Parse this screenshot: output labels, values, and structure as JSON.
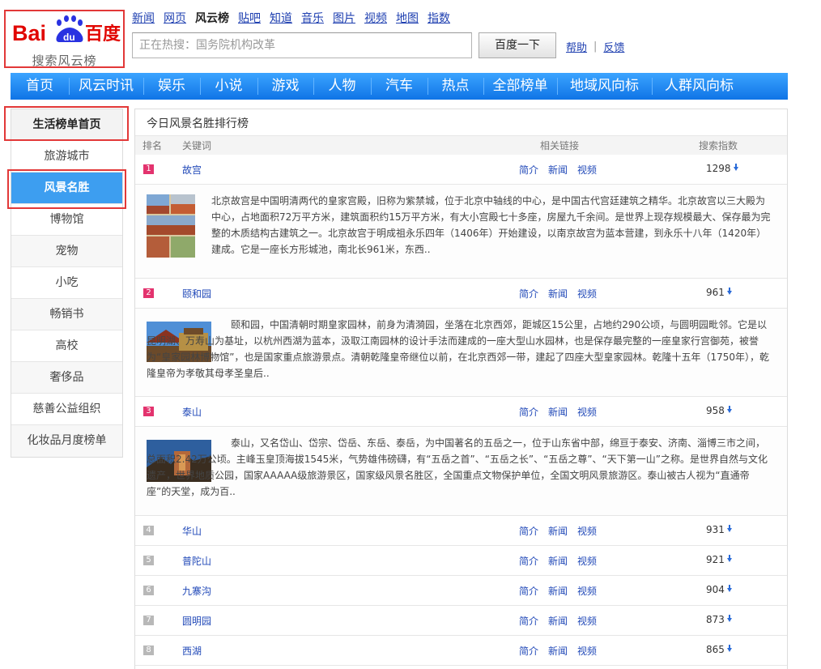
{
  "logo": {
    "text": "Bai百度",
    "du": "du",
    "sub": "搜索风云榜"
  },
  "topnav": [
    "新闻",
    "网页",
    "风云榜",
    "贴吧",
    "知道",
    "音乐",
    "图片",
    "视频",
    "地图",
    "指数"
  ],
  "search": {
    "placeholder": "正在热搜：国务院机构改革",
    "button": "百度一下",
    "help": "帮助",
    "sep": "|",
    "feedback": "反馈"
  },
  "mainnav": [
    "首页",
    "风云时讯",
    "娱乐",
    "小说",
    "游戏",
    "人物",
    "汽车",
    "热点",
    "全部榜单",
    "地域风向标",
    "人群风向标"
  ],
  "sidebar": [
    "生活榜单首页",
    "旅游城市",
    "风景名胜",
    "博物馆",
    "宠物",
    "小吃",
    "畅销书",
    "高校",
    "奢侈品",
    "慈善公益组织",
    "化妆品月度榜单"
  ],
  "panel": {
    "title": "今日风景名胜排行榜",
    "cols": {
      "rank": "排名",
      "keyword": "关键词",
      "links": "相关链接",
      "index": "搜索指数"
    },
    "link_labels": [
      "简介",
      "新闻",
      "视频"
    ]
  },
  "rows": [
    {
      "rank": "1",
      "kw": "故宫",
      "idx": "1298",
      "desc": "北京故宫是中国明清两代的皇家宫殿，旧称为紫禁城，位于北京中轴线的中心，是中国古代宫廷建筑之精华。北京故宫以三大殿为中心，占地面积72万平方米，建筑面积约15万平方米，有大小宫殿七十多座，房屋九千余间。是世界上现存规模最大、保存最为完整的木质结构古建筑之一。北京故宫于明成祖永乐四年（1406年）开始建设，以南京故宫为蓝本营建，到永乐十八年（1420年）建成。它是一座长方形城池，南北长961米，东西.."
    },
    {
      "rank": "2",
      "kw": "颐和园",
      "idx": "961",
      "desc": "颐和园，中国清朝时期皇家园林，前身为清漪园，坐落在北京西郊，距城区15公里，占地约290公顷，与圆明园毗邻。它是以昆明湖、万寿山为基址，以杭州西湖为蓝本，汲取江南园林的设计手法而建成的一座大型山水园林，也是保存最完整的一座皇家行宫御苑，被誉为“皇家园林博物馆”，也是国家重点旅游景点。清朝乾隆皇帝继位以前，在北京西郊一带，建起了四座大型皇家园林。乾隆十五年（1750年），乾隆皇帝为孝敬其母孝圣皇后.."
    },
    {
      "rank": "3",
      "kw": "泰山",
      "idx": "958",
      "desc": "泰山，又名岱山、岱宗、岱岳、东岳、泰岳，为中国著名的五岳之一，位于山东省中部，绵亘于泰安、济南、淄博三市之间，总面积2.42万公顷。主峰玉皇顶海拔1545米，气势雄伟磅礴，有“五岳之首”、“五岳之长”、“五岳之尊”、“天下第一山”之称。是世界自然与文化遗产，世界地质公园，国家AAAAA级旅游景区，国家级风景名胜区，全国重点文物保护单位，全国文明风景旅游区。泰山被古人视为“直通帝座”的天堂，成为百.."
    },
    {
      "rank": "4",
      "kw": "华山",
      "idx": "931"
    },
    {
      "rank": "5",
      "kw": "普陀山",
      "idx": "921"
    },
    {
      "rank": "6",
      "kw": "九寨沟",
      "idx": "904"
    },
    {
      "rank": "7",
      "kw": "圆明园",
      "idx": "873"
    },
    {
      "rank": "8",
      "kw": "西湖",
      "idx": "865"
    }
  ],
  "colors": {
    "accent": "#1a7ff0",
    "highlight": "#e23838",
    "rank_top": "#e3336e"
  }
}
